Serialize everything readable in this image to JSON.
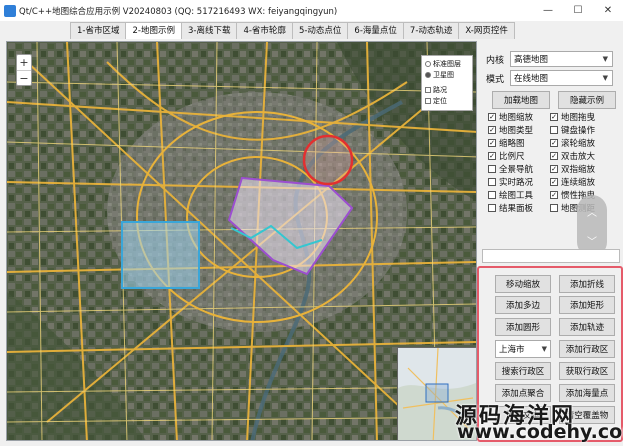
{
  "window": {
    "title": "Qt/C++地图综合应用示例 V20240803 (QQ: 517216493 WX: feiyangqingyun)",
    "min_label": "—",
    "max_label": "☐",
    "close_label": "✕"
  },
  "tabs": [
    {
      "label": "1-省市区域"
    },
    {
      "label": "2-地图示例",
      "active": true
    },
    {
      "label": "3-离线下载"
    },
    {
      "label": "4-省市轮廓"
    },
    {
      "label": "5-动态点位"
    },
    {
      "label": "6-海量点位"
    },
    {
      "label": "7-动态轨迹"
    },
    {
      "label": "X-网页控件"
    }
  ],
  "map": {
    "zoom_in": "+",
    "zoom_out": "−",
    "map_type_options": [
      "标准图层",
      "卫星图"
    ],
    "map_type_selected": "卫星图",
    "overlay_options": [
      "路况",
      "定位"
    ]
  },
  "side": {
    "kernel_label": "内核",
    "kernel_value": "高德地图",
    "mode_label": "模式",
    "mode_value": "在线地图",
    "load_map_button": "加载地图",
    "demo_button": "隐藏示例",
    "checkboxes": [
      {
        "label": "地图缩放",
        "checked": true
      },
      {
        "label": "地图拖曳",
        "checked": true
      },
      {
        "label": "地图类型",
        "checked": true
      },
      {
        "label": "键盘操作",
        "checked": false
      },
      {
        "label": "缩略图",
        "checked": true
      },
      {
        "label": "滚轮缩放",
        "checked": true
      },
      {
        "label": "比例尺",
        "checked": true
      },
      {
        "label": "双击放大",
        "checked": true
      },
      {
        "label": "全景导航",
        "checked": false
      },
      {
        "label": "双指缩放",
        "checked": true
      },
      {
        "label": "实时路况",
        "checked": false
      },
      {
        "label": "连续缩放",
        "checked": true
      },
      {
        "label": "绘图工具",
        "checked": false
      },
      {
        "label": "惯性拖曳",
        "checked": true
      },
      {
        "label": "结果面板",
        "checked": false
      },
      {
        "label": "地图测距",
        "checked": false
      }
    ],
    "scroll_up": "︿",
    "scroll_down": "﹀",
    "actions": {
      "move_zoom": "移动缩放",
      "add_polyline": "添加折线",
      "add_polygon": "添加多边",
      "add_rectangle": "添加矩形",
      "add_circle": "添加圆形",
      "add_trajectory": "添加轨迹",
      "city_value": "上海市",
      "add_district": "添加行政区",
      "search_district": "搜索行政区",
      "get_district": "获取行政区",
      "add_cluster": "添加点聚合",
      "add_massive": "添加海量点",
      "add_mark": "添加文本",
      "clear_all": "清空覆盖物"
    }
  },
  "watermark": {
    "line1": "源码海洋网",
    "line2": "www.codehy.com"
  }
}
